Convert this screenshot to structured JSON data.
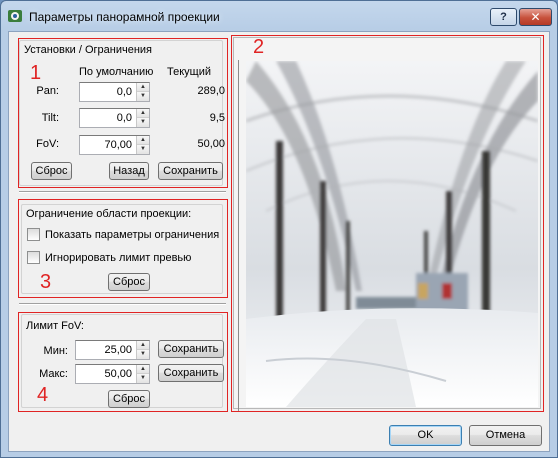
{
  "window": {
    "title": "Параметры панорамной проекции",
    "help_label": "?",
    "close_label": "✕"
  },
  "icons": {
    "app": "app-icon",
    "help": "help-icon",
    "close": "close-icon"
  },
  "annotations": {
    "n1": "1",
    "n2": "2",
    "n3": "3",
    "n4": "4",
    "color": "#e02424"
  },
  "settings": {
    "title": "Установки / Ограничения",
    "col_default": "По умолчанию",
    "col_current": "Текущий",
    "rows": [
      {
        "label": "Pan:",
        "default_value": "0,0",
        "current": "289,0"
      },
      {
        "label": "Tilt:",
        "default_value": "0,0",
        "current": "9,5"
      },
      {
        "label": "FoV:",
        "default_value": "70,00",
        "current": "50,00"
      }
    ],
    "reset_label": "Сброс",
    "back_label": "Назад",
    "save_label": "Сохранить"
  },
  "limits": {
    "title": "Ограничение области проекции:",
    "show_params_label": "Показать параметры ограничения",
    "show_params_checked": false,
    "ignore_preview_label": "Игнорировать лимит превью",
    "ignore_preview_checked": false,
    "reset_label": "Сброс"
  },
  "fov_limit": {
    "title": "Лимит FoV:",
    "min_label": "Мин:",
    "min_value": "25,00",
    "max_label": "Макс:",
    "max_value": "50,00",
    "save_min_label": "Сохранить",
    "save_max_label": "Сохранить",
    "reset_label": "Сброс"
  },
  "footer": {
    "ok_label": "OK",
    "cancel_label": "Отмена"
  }
}
